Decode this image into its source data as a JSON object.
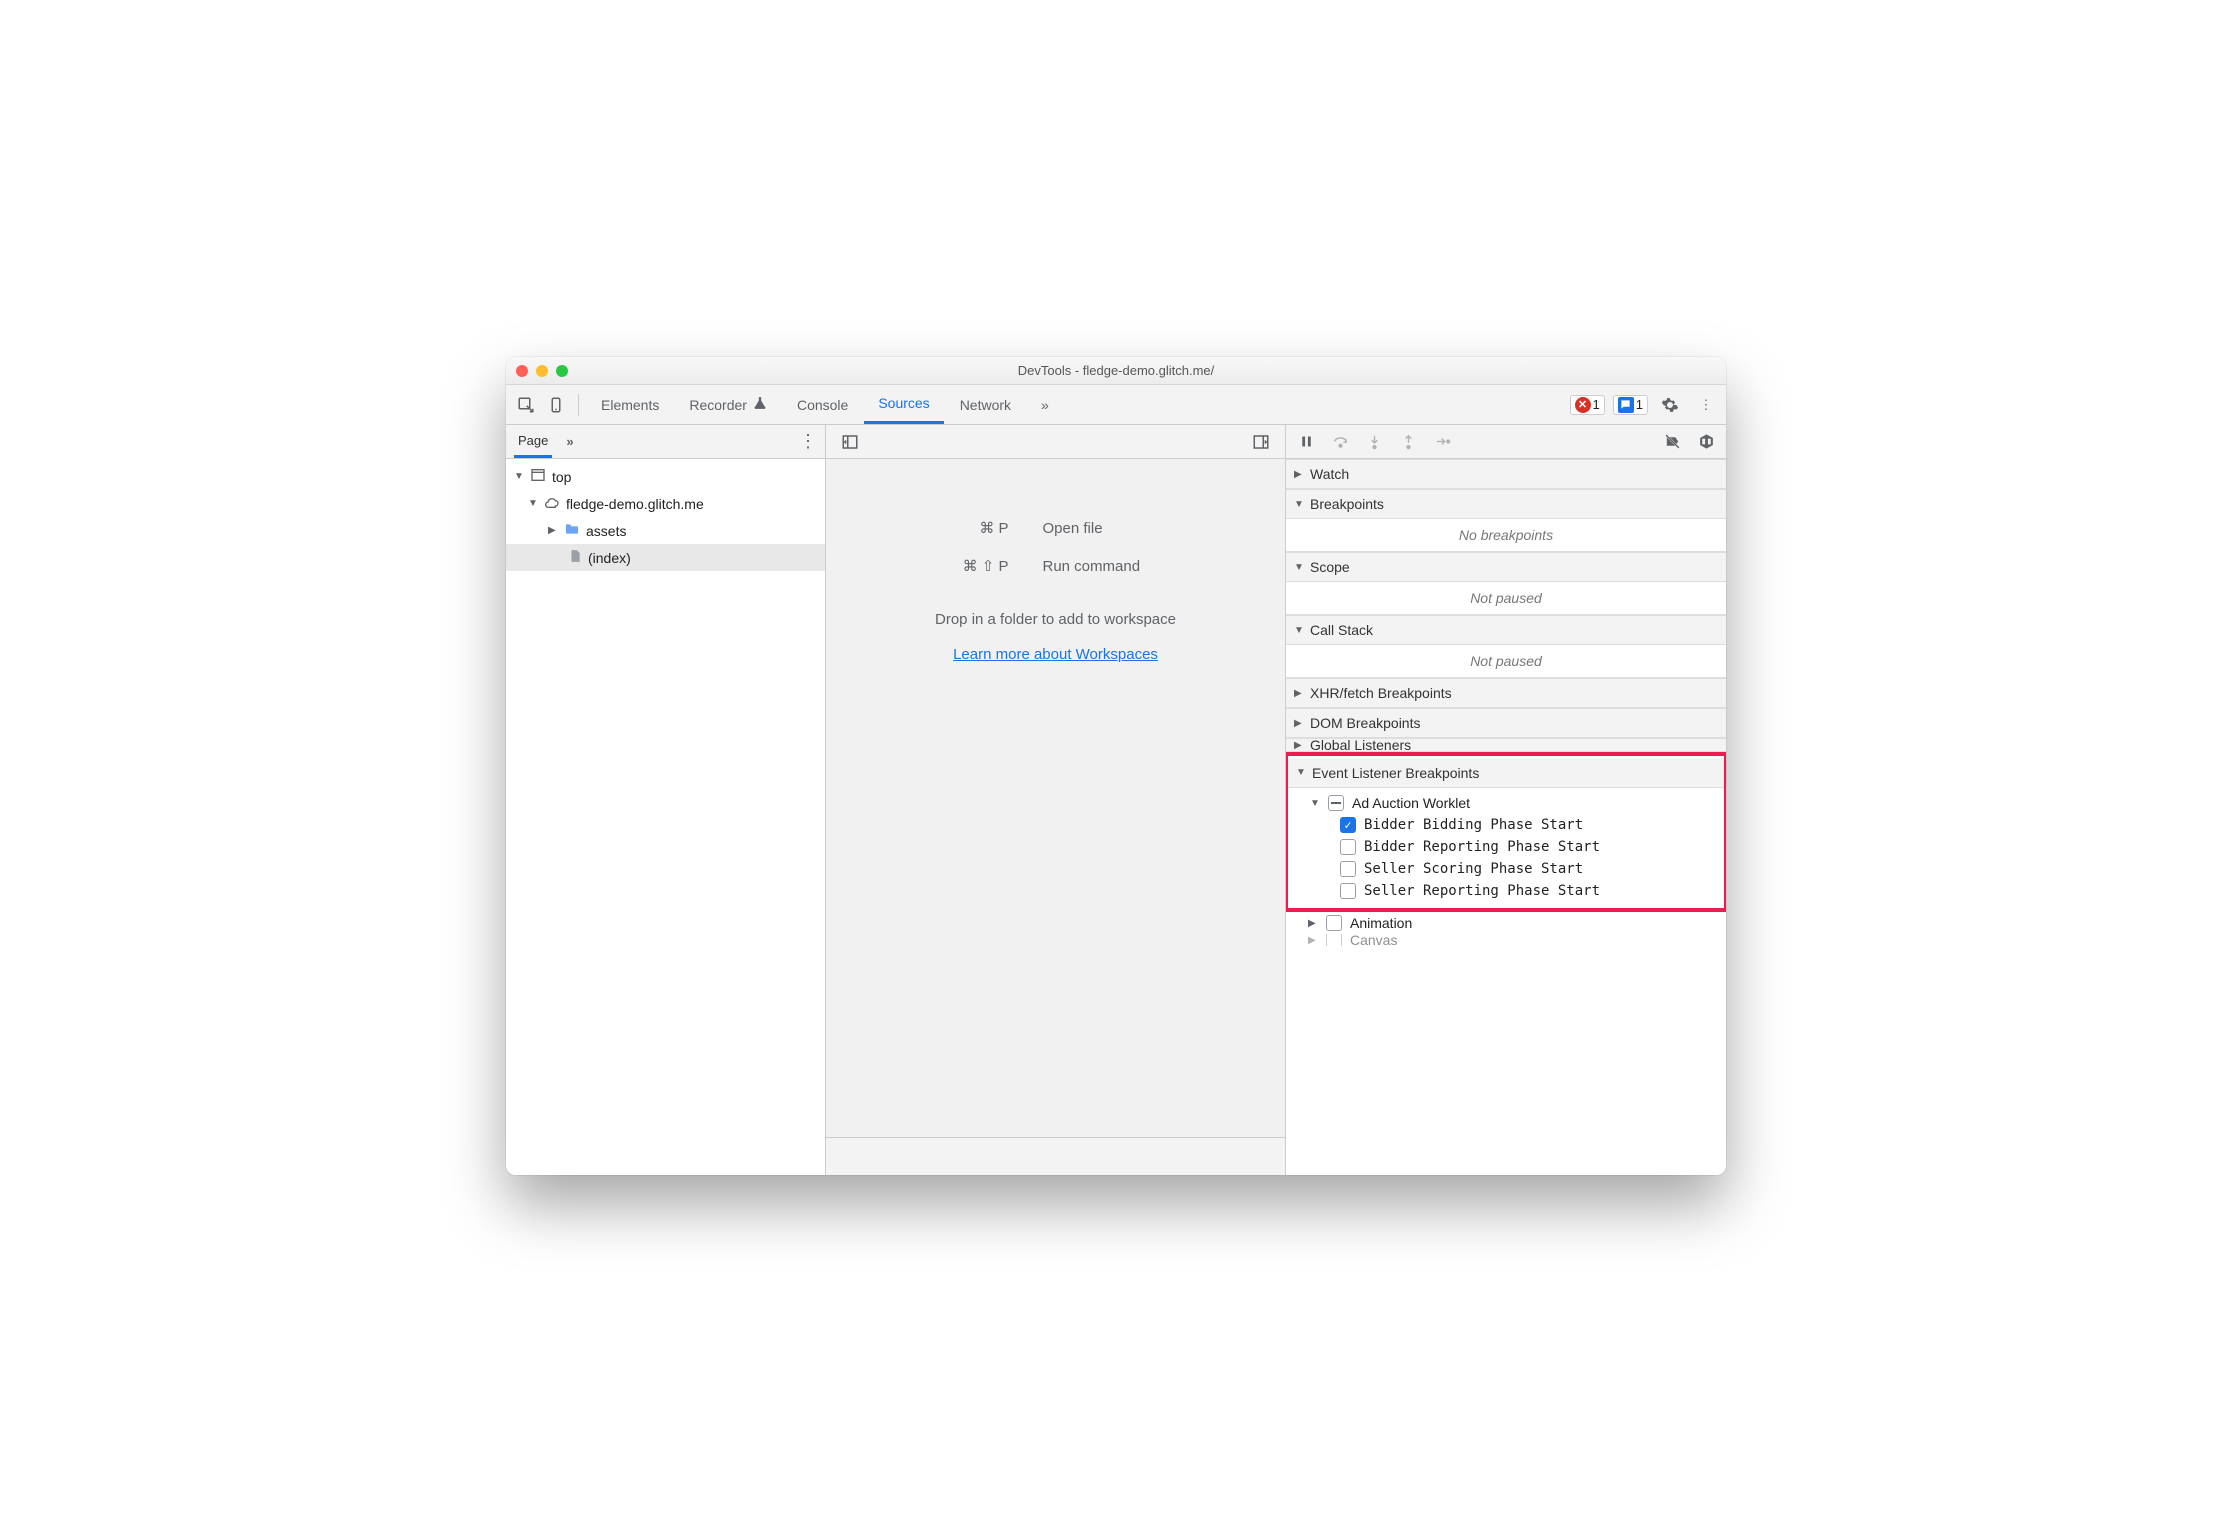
{
  "titlebar": {
    "title": "DevTools - fledge-demo.glitch.me/"
  },
  "mainTabs": {
    "items": [
      "Elements",
      "Recorder",
      "Console",
      "Sources",
      "Network"
    ],
    "activeIndex": 3,
    "overflow": "»"
  },
  "badges": {
    "errors": "1",
    "messages": "1"
  },
  "navigator": {
    "tabs": {
      "active": "Page",
      "overflow": "»"
    },
    "tree": {
      "top": "top",
      "domain": "fledge-demo.glitch.me",
      "folder": "assets",
      "file": "(index)"
    }
  },
  "center": {
    "openFileKbd": "⌘ P",
    "openFileLabel": "Open file",
    "runCmdKbd": "⌘ ⇧ P",
    "runCmdLabel": "Run command",
    "dropHint": "Drop in a folder to add to workspace",
    "learnLink": "Learn more about Workspaces"
  },
  "debugger": {
    "panes": {
      "watch": "Watch",
      "breakpoints": "Breakpoints",
      "breakpointsEmpty": "No breakpoints",
      "scope": "Scope",
      "scopeEmpty": "Not paused",
      "callstack": "Call Stack",
      "callstackEmpty": "Not paused",
      "xhr": "XHR/fetch Breakpoints",
      "dom": "DOM Breakpoints",
      "global": "Global Listeners",
      "eventListener": "Event Listener Breakpoints",
      "animation": "Animation",
      "canvas": "Canvas"
    },
    "adAuction": {
      "group": "Ad Auction Worklet",
      "items": [
        {
          "label": "Bidder Bidding Phase Start",
          "checked": true
        },
        {
          "label": "Bidder Reporting Phase Start",
          "checked": false
        },
        {
          "label": "Seller Scoring Phase Start",
          "checked": false
        },
        {
          "label": "Seller Reporting Phase Start",
          "checked": false
        }
      ]
    }
  }
}
